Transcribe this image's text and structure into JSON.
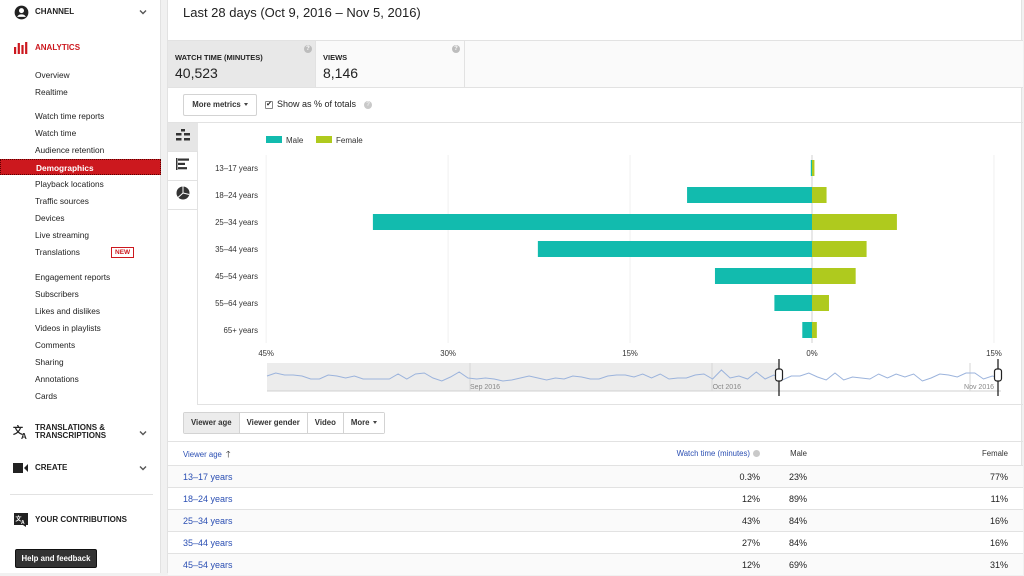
{
  "sidebar": {
    "channel_label": "CHANNEL",
    "analytics_label": "ANALYTICS",
    "items": [
      {
        "label": "Overview",
        "type": "link"
      },
      {
        "label": "Realtime",
        "type": "link"
      },
      {
        "label": "Watch time reports",
        "type": "heading"
      },
      {
        "label": "Watch time",
        "type": "link"
      },
      {
        "label": "Audience retention",
        "type": "link"
      },
      {
        "label": "Demographics",
        "type": "link",
        "active": true
      },
      {
        "label": "Playback locations",
        "type": "link"
      },
      {
        "label": "Traffic sources",
        "type": "link"
      },
      {
        "label": "Devices",
        "type": "link"
      },
      {
        "label": "Live streaming",
        "type": "link"
      },
      {
        "label": "Translations",
        "type": "link",
        "badge": "NEW"
      },
      {
        "label": "Engagement reports",
        "type": "heading"
      },
      {
        "label": "Subscribers",
        "type": "link"
      },
      {
        "label": "Likes and dislikes",
        "type": "link"
      },
      {
        "label": "Videos in playlists",
        "type": "link"
      },
      {
        "label": "Comments",
        "type": "link"
      },
      {
        "label": "Sharing",
        "type": "link"
      },
      {
        "label": "Annotations",
        "type": "link"
      },
      {
        "label": "Cards",
        "type": "link"
      }
    ],
    "translations_label_1": "TRANSLATIONS &",
    "translations_label_2": "TRANSCRIPTIONS",
    "create_label": "CREATE",
    "contributions_label": "YOUR CONTRIBUTIONS",
    "help_button": "Help and feedback",
    "accent_color": "#cc181e"
  },
  "header": {
    "date_range": "Last 28 days (Oct 9, 2016 – Nov 5, 2016)"
  },
  "metrics": [
    {
      "label": "WATCH TIME (MINUTES)",
      "value": "40,523",
      "active": true
    },
    {
      "label": "VIEWS",
      "value": "8,146",
      "active": false
    }
  ],
  "toolbar": {
    "more_metrics": "More metrics",
    "show_pct_label": "Show as % of totals",
    "show_pct_checked": true
  },
  "view_tabs": [
    {
      "icon": "multi-line-chart-icon",
      "active": true
    },
    {
      "icon": "bar-chart-icon",
      "active": false
    },
    {
      "icon": "pie-chart-icon",
      "active": false
    }
  ],
  "chart_data": {
    "type": "bar",
    "orientation": "horizontal-diverging",
    "categories": [
      "13–17 years",
      "18–24 years",
      "25–34 years",
      "35–44 years",
      "45–54 years",
      "55–64 years",
      "65+ years"
    ],
    "series": [
      {
        "name": "Male",
        "color": "#12bbae",
        "values": [
          0.07,
          10.3,
          36.2,
          22.6,
          8.0,
          3.1,
          0.8
        ]
      },
      {
        "name": "Female",
        "color": "#afca1e",
        "values": [
          0.2,
          1.2,
          7.0,
          4.5,
          3.6,
          1.4,
          0.4
        ]
      }
    ],
    "x_tick_labels": [
      "45%",
      "30%",
      "15%",
      "0%",
      "15%"
    ],
    "x_ticks": [
      -45,
      -30,
      -15,
      0,
      15
    ],
    "xlim": [
      -45,
      15
    ],
    "legend": "top-left",
    "grid": true
  },
  "timeline": {
    "labels": [
      "Sep 2016",
      "Oct 2016",
      "Nov 2016"
    ],
    "series_color": "#9bb3dc"
  },
  "dimension_tabs": [
    {
      "label": "Viewer age",
      "active": true
    },
    {
      "label": "Viewer gender",
      "active": false
    },
    {
      "label": "Video",
      "active": false
    },
    {
      "label": "More",
      "active": false,
      "dropdown": true
    }
  ],
  "table": {
    "headers": {
      "age": "Viewer age",
      "watch_time": "Watch time (minutes)",
      "male": "Male",
      "female": "Female"
    },
    "sort": "ascending",
    "rows": [
      {
        "age": "13–17 years",
        "watch_time": "0.3%",
        "male": "23%",
        "female": "77%"
      },
      {
        "age": "18–24 years",
        "watch_time": "12%",
        "male": "89%",
        "female": "11%"
      },
      {
        "age": "25–34 years",
        "watch_time": "43%",
        "male": "84%",
        "female": "16%"
      },
      {
        "age": "35–44 years",
        "watch_time": "27%",
        "male": "84%",
        "female": "16%"
      },
      {
        "age": "45–54 years",
        "watch_time": "12%",
        "male": "69%",
        "female": "31%"
      }
    ]
  }
}
